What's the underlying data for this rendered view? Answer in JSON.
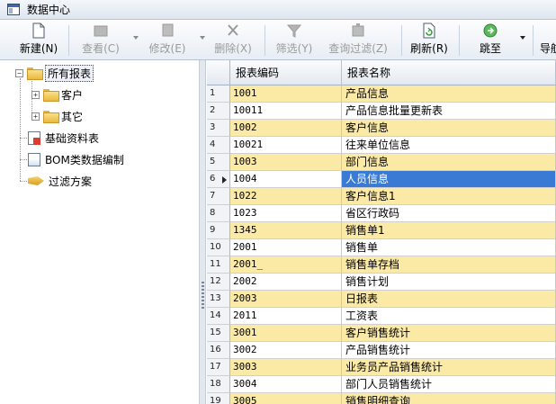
{
  "window": {
    "title": "数据中心"
  },
  "toolbar": {
    "new_label": "新建(N)",
    "view_label": "查看(C)",
    "edit_label": "修改(E)",
    "delete_label": "删除(X)",
    "filter_label": "筛选(Y)",
    "query_filter_label": "查询过滤(Z)",
    "refresh_label": "刷新(R)",
    "jump_label": "跳至",
    "guide_label": "导航"
  },
  "tree": {
    "root": "所有报表",
    "children": [
      "客户",
      "其它"
    ],
    "items": [
      "基础资料表",
      "BOM类数据编制",
      "过滤方案"
    ]
  },
  "grid": {
    "columns": [
      "报表编码",
      "报表名称"
    ],
    "current_row": 6,
    "rows": [
      {
        "num": "1",
        "code": "1001",
        "name": "产品信息"
      },
      {
        "num": "2",
        "code": "10011",
        "name": "产品信息批量更新表"
      },
      {
        "num": "3",
        "code": "1002",
        "name": "客户信息"
      },
      {
        "num": "4",
        "code": "10021",
        "name": "往来单位信息"
      },
      {
        "num": "5",
        "code": "1003",
        "name": "部门信息"
      },
      {
        "num": "6",
        "code": "1004",
        "name": "人员信息"
      },
      {
        "num": "7",
        "code": "1022",
        "name": "客户信息1"
      },
      {
        "num": "8",
        "code": "1023",
        "name": "省区行政码"
      },
      {
        "num": "9",
        "code": "1345",
        "name": "销售单1"
      },
      {
        "num": "10",
        "code": "2001",
        "name": "销售单"
      },
      {
        "num": "11",
        "code": "2001_",
        "name": "销售单存档"
      },
      {
        "num": "12",
        "code": "2002",
        "name": "销售计划"
      },
      {
        "num": "13",
        "code": "2003",
        "name": "日报表"
      },
      {
        "num": "14",
        "code": "2011",
        "name": "工资表"
      },
      {
        "num": "15",
        "code": "3001",
        "name": "客户销售统计"
      },
      {
        "num": "16",
        "code": "3002",
        "name": "产品销售统计"
      },
      {
        "num": "17",
        "code": "3003",
        "name": "业务员产品销售统计"
      },
      {
        "num": "18",
        "code": "3004",
        "name": "部门人员销售统计"
      },
      {
        "num": "19",
        "code": "3005",
        "name": "销售明细查询"
      }
    ]
  }
}
